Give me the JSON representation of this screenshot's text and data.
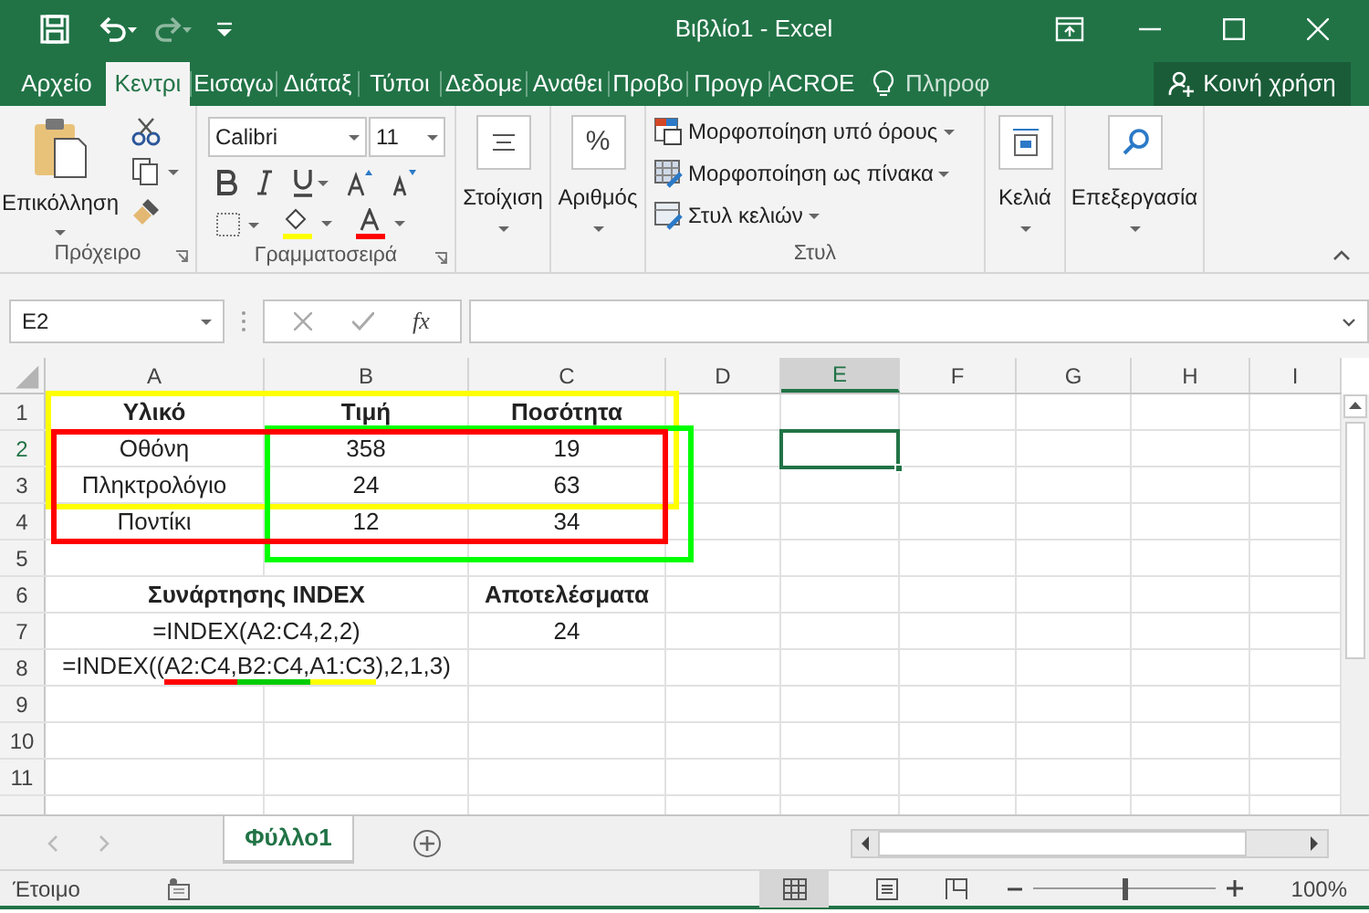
{
  "window": {
    "title": "Βιβλίο1 - Excel"
  },
  "ribbon_tabs": [
    {
      "label": "Αρχείο",
      "selected": false
    },
    {
      "label": "Κεντρι",
      "selected": true
    },
    {
      "label": "Εισαγω",
      "selected": false
    },
    {
      "label": "Διάταξ",
      "selected": false
    },
    {
      "label": "Τύποι",
      "selected": false
    },
    {
      "label": "Δεδομε",
      "selected": false
    },
    {
      "label": "Αναθει",
      "selected": false
    },
    {
      "label": "Προβο",
      "selected": false
    },
    {
      "label": "Προγρ",
      "selected": false
    },
    {
      "label": "ACROE",
      "selected": false
    }
  ],
  "tell_me": {
    "placeholder": "Πληροφ"
  },
  "share_button": {
    "label": "Κοινή χρήση"
  },
  "ribbon": {
    "clipboard": {
      "paste": "Επικόλληση",
      "label": "Πρόχειρο"
    },
    "font": {
      "font_name": "Calibri",
      "font_size": "11",
      "label": "Γραμματοσειρά"
    },
    "alignment": {
      "label": "Στοίχιση"
    },
    "number": {
      "symbol": "%",
      "label": "Αριθμός"
    },
    "styles": {
      "items": [
        "Μορφοποίηση υπό όρους",
        "Μορφοποίηση ως πίνακα",
        "Στυλ κελιών"
      ],
      "label": "Στυλ"
    },
    "cells": {
      "label": "Κελιά"
    },
    "editing": {
      "label": "Επεξεργασία"
    }
  },
  "formula_bar": {
    "name_box": "E2",
    "function_label": "fx"
  },
  "columns": [
    {
      "label": "A",
      "selected": false
    },
    {
      "label": "B",
      "selected": false
    },
    {
      "label": "C",
      "selected": false
    },
    {
      "label": "D",
      "selected": false
    },
    {
      "label": "E",
      "selected": true
    },
    {
      "label": "F",
      "selected": false
    },
    {
      "label": "G",
      "selected": false
    },
    {
      "label": "H",
      "selected": false
    },
    {
      "label": "I",
      "selected": false
    }
  ],
  "rows": [
    {
      "number": "1",
      "selected": false,
      "cells": [
        {
          "text": "Υλικό",
          "bold": true
        },
        {
          "text": "Τιμή",
          "bold": true
        },
        {
          "text": "Ποσότητα",
          "bold": true
        }
      ]
    },
    {
      "number": "2",
      "selected": true,
      "cells": [
        {
          "text": "Οθόνη",
          "bold": false
        },
        {
          "text": "358",
          "bold": false
        },
        {
          "text": "19",
          "bold": false
        }
      ]
    },
    {
      "number": "3",
      "selected": false,
      "cells": [
        {
          "text": "Πληκτρολόγιο",
          "bold": false
        },
        {
          "text": "24",
          "bold": false
        },
        {
          "text": "63",
          "bold": false
        }
      ]
    },
    {
      "number": "4",
      "selected": false,
      "cells": [
        {
          "text": "Ποντίκι",
          "bold": false
        },
        {
          "text": "12",
          "bold": false
        },
        {
          "text": "34",
          "bold": false
        }
      ]
    },
    {
      "number": "5",
      "selected": false,
      "cells": []
    },
    {
      "number": "6",
      "selected": false,
      "cells": [
        {
          "text": "Συνάρτησης INDEX",
          "bold": true,
          "merged": true
        },
        {
          "text": "Αποτελέσματα",
          "bold": true
        }
      ]
    },
    {
      "number": "7",
      "selected": false,
      "cells": [
        {
          "text": "=INDEX(A2:C4,2,2)",
          "bold": false,
          "merged": true
        },
        {
          "text": "24",
          "bold": false
        }
      ]
    },
    {
      "number": "8",
      "selected": false,
      "cells": [
        {
          "merged": true,
          "segments": [
            {
              "text": "=INDEX(("
            },
            {
              "text": "A2:C4,",
              "color": "#ff0000"
            },
            {
              "text": "B2:C4,",
              "color": "#00cc00"
            },
            {
              "text": "A1:C3",
              "color": "#ffff00"
            },
            {
              "text": "),2,1,3)"
            }
          ]
        }
      ]
    },
    {
      "number": "9",
      "selected": false,
      "cells": []
    },
    {
      "number": "10",
      "selected": false,
      "cells": []
    },
    {
      "number": "11",
      "selected": false,
      "cells": []
    }
  ],
  "highlights": [
    {
      "color": "#ffff00"
    },
    {
      "color": "#00ff00"
    },
    {
      "color": "#ff0000"
    }
  ],
  "sheet_tabs": [
    {
      "label": "Φύλλο1",
      "selected": true
    }
  ],
  "status_bar": {
    "status": "Έτοιμο",
    "zoom_slider": {
      "level": 0.5
    },
    "zoom": "100%"
  }
}
